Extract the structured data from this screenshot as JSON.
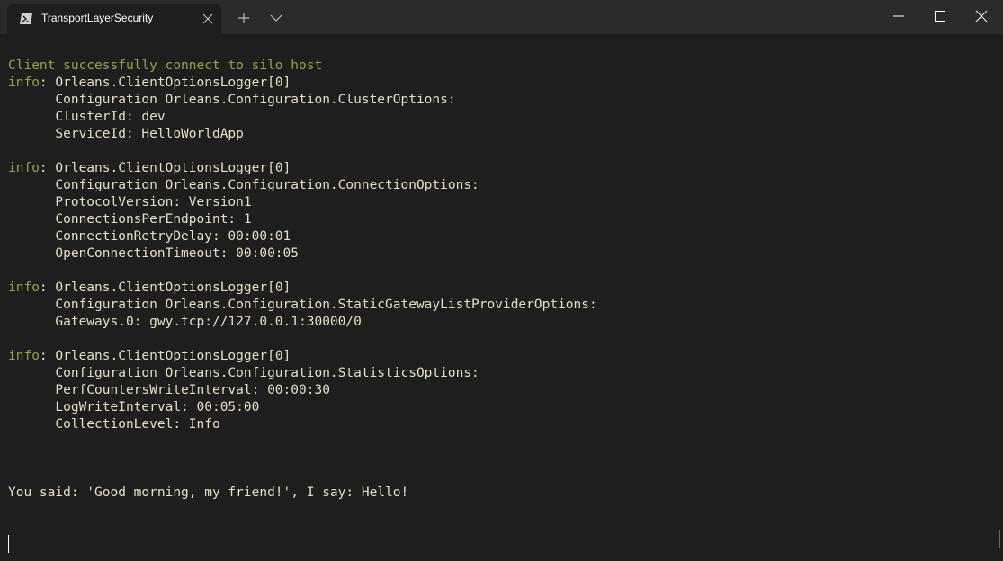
{
  "window": {
    "tab_title": "TransportLayerSecurity",
    "icons": {
      "tab": "powershell-icon",
      "close_tab": "close-icon",
      "new_tab": "plus-icon",
      "dropdown": "chevron-down-icon",
      "minimize": "minimize-icon",
      "maximize": "maximize-icon",
      "close_window": "close-icon"
    },
    "colors": {
      "titlebar": "#2b2b2b",
      "background": "#1e1e1e",
      "text": "#e6dfc4",
      "info_text": "#98a24a"
    }
  },
  "terminal": {
    "lines": [
      {
        "prefix": "",
        "text": "Client successfully connect to silo host",
        "green": true
      },
      {
        "prefix": "info",
        "text": ": Orleans.ClientOptionsLogger[0]"
      },
      {
        "prefix": "",
        "text": "      Configuration Orleans.Configuration.ClusterOptions:"
      },
      {
        "prefix": "",
        "text": "      ClusterId: dev"
      },
      {
        "prefix": "",
        "text": "      ServiceId: HelloWorldApp"
      },
      {
        "prefix": "",
        "text": ""
      },
      {
        "prefix": "info",
        "text": ": Orleans.ClientOptionsLogger[0]"
      },
      {
        "prefix": "",
        "text": "      Configuration Orleans.Configuration.ConnectionOptions:"
      },
      {
        "prefix": "",
        "text": "      ProtocolVersion: Version1"
      },
      {
        "prefix": "",
        "text": "      ConnectionsPerEndpoint: 1"
      },
      {
        "prefix": "",
        "text": "      ConnectionRetryDelay: 00:00:01"
      },
      {
        "prefix": "",
        "text": "      OpenConnectionTimeout: 00:00:05"
      },
      {
        "prefix": "",
        "text": ""
      },
      {
        "prefix": "info",
        "text": ": Orleans.ClientOptionsLogger[0]"
      },
      {
        "prefix": "",
        "text": "      Configuration Orleans.Configuration.StaticGatewayListProviderOptions:"
      },
      {
        "prefix": "",
        "text": "      Gateways.0: gwy.tcp://127.0.0.1:30000/0"
      },
      {
        "prefix": "",
        "text": ""
      },
      {
        "prefix": "info",
        "text": ": Orleans.ClientOptionsLogger[0]"
      },
      {
        "prefix": "",
        "text": "      Configuration Orleans.Configuration.StatisticsOptions:"
      },
      {
        "prefix": "",
        "text": "      PerfCountersWriteInterval: 00:00:30"
      },
      {
        "prefix": "",
        "text": "      LogWriteInterval: 00:05:00"
      },
      {
        "prefix": "",
        "text": "      CollectionLevel: Info"
      },
      {
        "prefix": "",
        "text": ""
      },
      {
        "prefix": "",
        "text": ""
      },
      {
        "prefix": "",
        "text": ""
      },
      {
        "prefix": "",
        "text": "You said: 'Good morning, my friend!', I say: Hello!"
      }
    ]
  }
}
